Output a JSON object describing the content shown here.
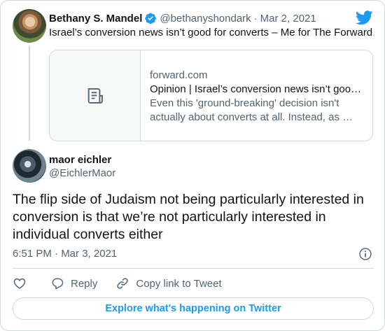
{
  "colors": {
    "accent": "#1d9bf0",
    "secondary_text": "#536471",
    "border": "#cfd9de",
    "text": "#0f1419"
  },
  "parent_tweet": {
    "name": "Bethany S. Mandel",
    "handle": "@bethanyshondark",
    "separator": "·",
    "date": "Mar 2, 2021",
    "text": "Israel’s conversion news isn’t good for converts – Me for The Forward",
    "link_card": {
      "domain": "forward.com",
      "title": "Opinion | Israel’s conversion news isn’t goo…",
      "description": "Even this 'ground-breaking' decision isn't actually about converts at all. Instead, as …",
      "thumbnail_icon": "document-icon"
    }
  },
  "tweet": {
    "name": "maor eichler",
    "handle": "@EichlerMaor",
    "text": "The flip side of Judaism not being particularly interested in conversion is that we’re not particularly interested in individual converts either",
    "timestamp": "6:51 PM · Mar 3, 2021"
  },
  "actions": {
    "reply_label": "Reply",
    "copy_label": "Copy link to Tweet"
  },
  "explore_label": "Explore what's happening on Twitter"
}
